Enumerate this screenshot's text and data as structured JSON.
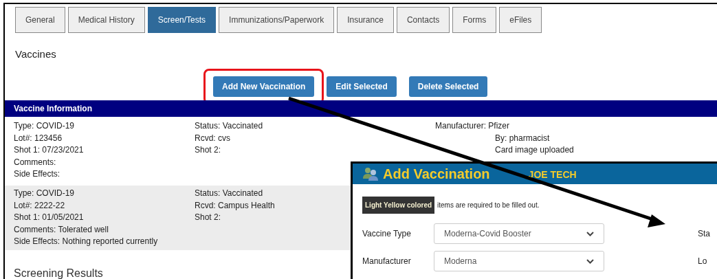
{
  "tabs": [
    {
      "label": "General",
      "selected": false
    },
    {
      "label": "Medical History",
      "selected": false
    },
    {
      "label": "Screen/Tests",
      "selected": true
    },
    {
      "label": "Immunizations/Paperwork",
      "selected": false
    },
    {
      "label": "Insurance",
      "selected": false
    },
    {
      "label": "Contacts",
      "selected": false
    },
    {
      "label": "Forms",
      "selected": false
    },
    {
      "label": "eFiles",
      "selected": false
    }
  ],
  "section_title": "Vaccines",
  "buttons": [
    {
      "label": "Add New Vaccination",
      "highlighted": true
    },
    {
      "label": "Edit Selected",
      "highlighted": false
    },
    {
      "label": "Delete Selected",
      "highlighted": false
    }
  ],
  "vaccine_table": {
    "header": "Vaccine Information",
    "records": [
      {
        "column_1": [
          "Type: COVID-19",
          "Lot#: 123456",
          "Shot 1: 07/23/2021",
          "Comments:",
          "Side Effects:"
        ],
        "column_2": [
          "Status: Vaccinated",
          "Rcvd: cvs",
          "Shot 2:"
        ],
        "manufacturer": "Manufacturer: Pfizer",
        "details": [
          "By: pharmacist",
          "Card image uploaded"
        ]
      },
      {
        "column_1": [
          "Type: COVID-19",
          "Lot#: 2222-22",
          "Shot 1: 01/05/2021",
          "Comments: Tolerated well",
          "Side Effects: Nothing reported currently"
        ],
        "column_2": [
          "Status: Vaccinated",
          "Rcvd: Campus Health",
          "Shot 2:"
        ]
      }
    ]
  },
  "next_section_title": "Screening Results",
  "popup": {
    "title": "Add Vaccination",
    "subtitle": "JOE TECH",
    "legend_badge": "Light Yellow colored",
    "legend_text": "items are required to be filled out.",
    "rows": [
      {
        "label": "Vaccine Type",
        "value": "Moderna-Covid Booster",
        "side_label": "Sta"
      },
      {
        "label": "Manufacturer",
        "value": "Moderna",
        "side_label": "Lo"
      }
    ]
  }
}
